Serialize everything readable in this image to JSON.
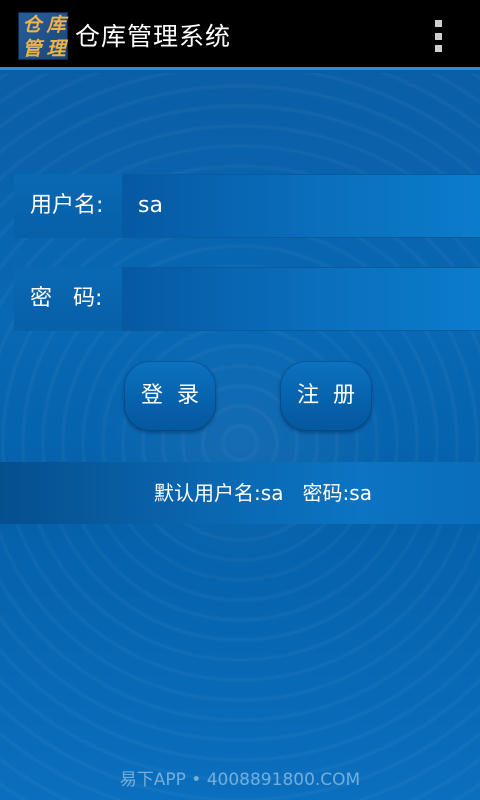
{
  "action_bar": {
    "logo_chars": [
      "仓",
      "库",
      "管",
      "理"
    ],
    "title": "仓库管理系统",
    "menu_icon": "overflow-menu-icon"
  },
  "form": {
    "username_label": "用户名:",
    "username_value": "sa",
    "password_label": "密   码:",
    "password_value": ""
  },
  "buttons": {
    "login_label": "登录",
    "register_label": "注册"
  },
  "hint": "默认用户名:sa   密码:sa",
  "watermark": "易下APP • 4008891800.COM",
  "colors": {
    "background": "#0560a8",
    "action_bar": "#000000",
    "accent": "#2b8fd6",
    "logo_text": "#f0b24a",
    "text": "#ffffff"
  }
}
